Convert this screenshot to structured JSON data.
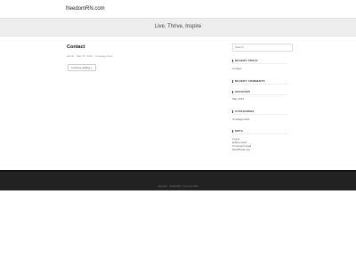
{
  "header": {
    "site_title": "freedomRN.com"
  },
  "tagline": "Live, Thrive, Inspire",
  "post": {
    "title": "Contact",
    "author": "admin",
    "date": "May 20, 2016",
    "category": "Uncategorized",
    "read_more": "Continue reading »"
  },
  "sidebar": {
    "search_placeholder": "Search",
    "recent_posts": {
      "title": "RECENT POSTS",
      "items": [
        "Contact"
      ]
    },
    "recent_comments": {
      "title": "RECENT COMMENTS"
    },
    "archives": {
      "title": "ARCHIVES",
      "items": [
        "May 2016"
      ]
    },
    "categories": {
      "title": "CATEGORIES",
      "items": [
        "Uncategorized"
      ]
    },
    "meta": {
      "title": "META",
      "items": [
        "Log in",
        "Entries feed",
        "Comments feed",
        "WordPress.org"
      ]
    }
  },
  "footer": {
    "copyright": "copyright · freedomRN · theme by ahkn"
  }
}
